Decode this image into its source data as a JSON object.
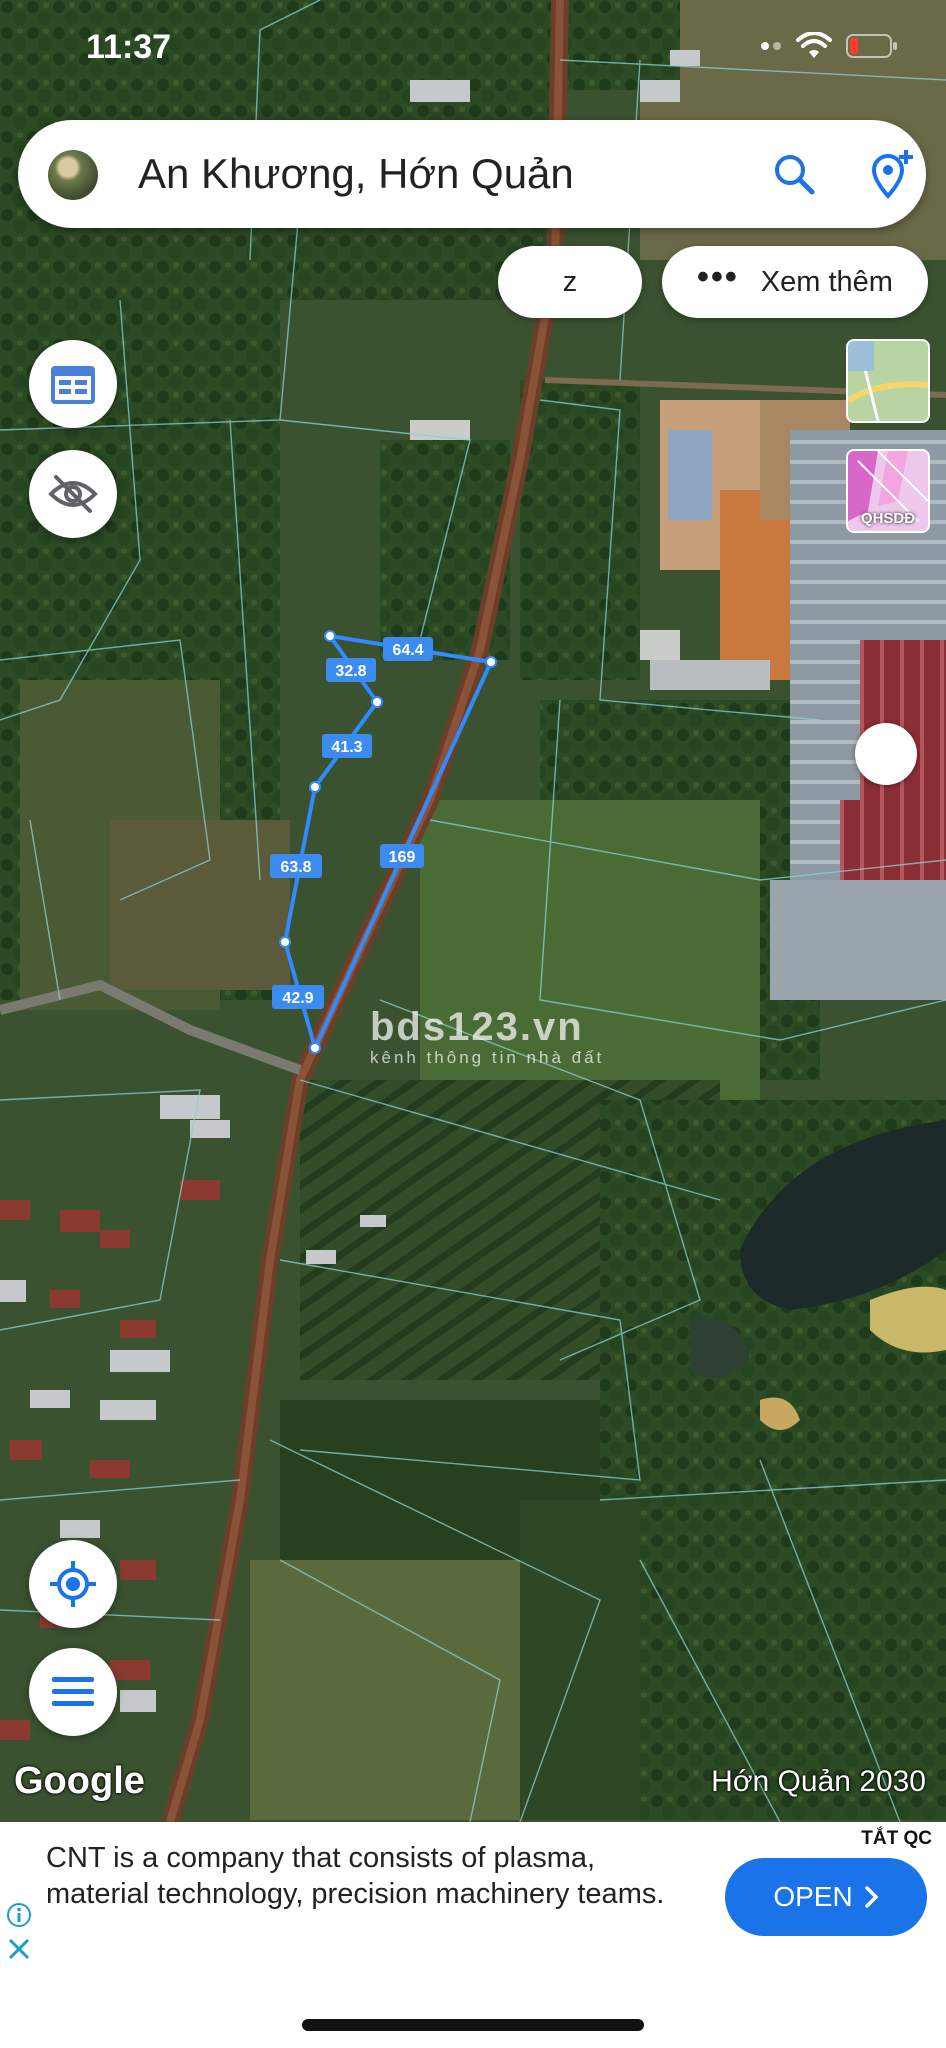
{
  "status_bar": {
    "time": "11:37"
  },
  "search": {
    "query": "An Khương, Hớn Quản"
  },
  "chips": {
    "z_label": "z",
    "more_label": "Xem thêm"
  },
  "layer_thumbnail": {
    "label": "QHSDĐ"
  },
  "map": {
    "parcel_edge_lengths": [
      "64.4",
      "32.8",
      "41.3",
      "63.8",
      "42.9",
      "169"
    ],
    "attribution": "Google",
    "caption": "Hớn Quản 2030",
    "watermark": "bds123.vn",
    "watermark_sub": "kênh thông tin nhà đất"
  },
  "ad": {
    "tag": "TẮT QC",
    "text": "CNT is a company that consists of plasma, material technology, precision machinery teams.",
    "button_label": "OPEN"
  },
  "colors": {
    "parcel_outline": "#2f8cff",
    "ad_button": "#1a73e8"
  },
  "icons": [
    "search-icon",
    "add-location-icon",
    "calendar-icon",
    "eye-off-icon",
    "my-location-icon",
    "menu-icon",
    "info-icon",
    "close-icon",
    "chevron-right-icon",
    "wifi-icon",
    "battery-icon"
  ]
}
